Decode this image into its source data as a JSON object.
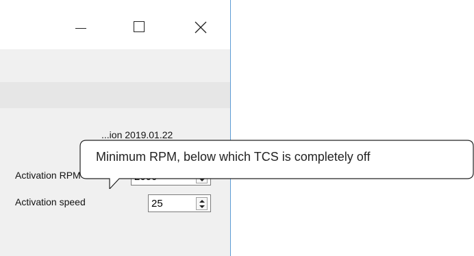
{
  "window": {
    "controls": {
      "minimize_icon": "minimize-icon",
      "maximize_icon": "maximize-icon",
      "close_icon": "close-icon"
    },
    "partial_text": "...ion 2019.01.22"
  },
  "form": {
    "activation_rpm": {
      "label": "Activation RPM",
      "value": "2000"
    },
    "activation_speed": {
      "label": "Activation speed",
      "value": "25"
    }
  },
  "tooltip": {
    "text": "Minimum RPM, below which TCS is completely off"
  },
  "colors": {
    "window_border": "#5b9bd5",
    "panel_bg": "#f0f0f0"
  }
}
